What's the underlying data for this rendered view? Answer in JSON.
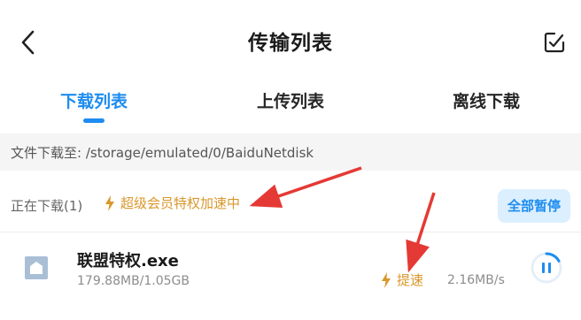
{
  "header": {
    "title": "传输列表",
    "back_icon": "chevron-left-icon",
    "edit_icon": "edit-checkbox-icon"
  },
  "tabs": [
    {
      "label": "下载列表",
      "active": true
    },
    {
      "label": "上传列表",
      "active": false
    },
    {
      "label": "离线下载",
      "active": false
    }
  ],
  "path_bar": {
    "text": "文件下载至: /storage/emulated/0/BaiduNetdisk"
  },
  "downloading": {
    "label": "正在下载(1)",
    "vip_text": "超级会员特权加速中",
    "pause_all_label": "全部暂停"
  },
  "file": {
    "name": "联盟特权.exe",
    "size": "179.88MB/1.05GB",
    "speedup_label": "提速",
    "speed": "2.16MB/s",
    "progress": 0.17
  },
  "colors": {
    "accent": "#1e8cf0",
    "vip": "#d9972b",
    "annotation": "#e53935"
  }
}
